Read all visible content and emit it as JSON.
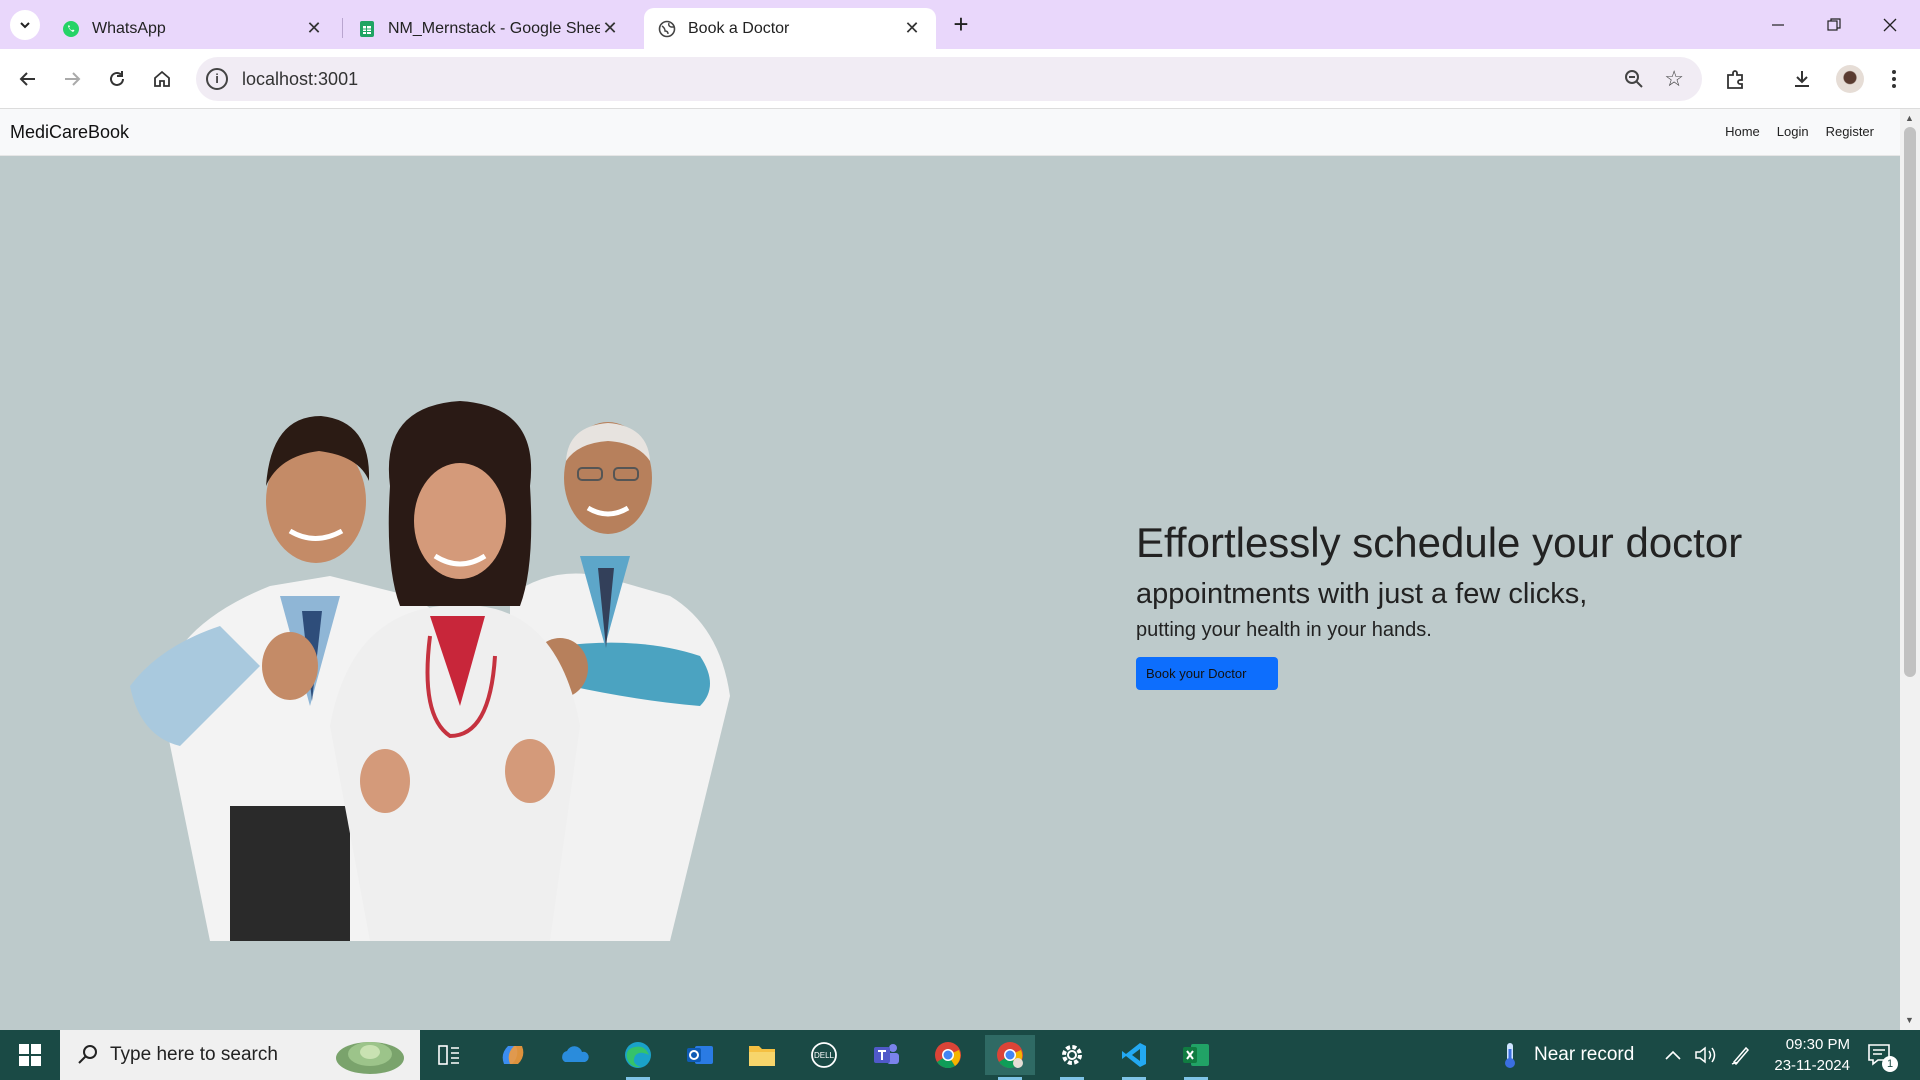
{
  "browser": {
    "tabs": [
      {
        "title": "WhatsApp",
        "icon": "whatsapp-icon"
      },
      {
        "title": "NM_Mernstack - Google Sheets",
        "icon": "google-sheets-icon"
      },
      {
        "title": "Book a Doctor",
        "icon": "globe-icon",
        "active": true
      }
    ],
    "url": "localhost:3001"
  },
  "site": {
    "brand": "MediCareBook",
    "nav": {
      "home": "Home",
      "login": "Login",
      "register": "Register"
    },
    "hero": {
      "headline": "Effortlessly schedule your doctor",
      "subheadline": "appointments with just a few clicks,",
      "tagline": "putting your health in your hands.",
      "cta_label": "Book your Doctor",
      "cta_color": "#0d6efd",
      "background": "#bdcacb"
    }
  },
  "taskbar": {
    "search_placeholder": "Type here to search",
    "weather": "Near record",
    "time": "09:30 PM",
    "date": "23-11-2024",
    "notification_count": "1",
    "accent": "#1a4a45"
  }
}
